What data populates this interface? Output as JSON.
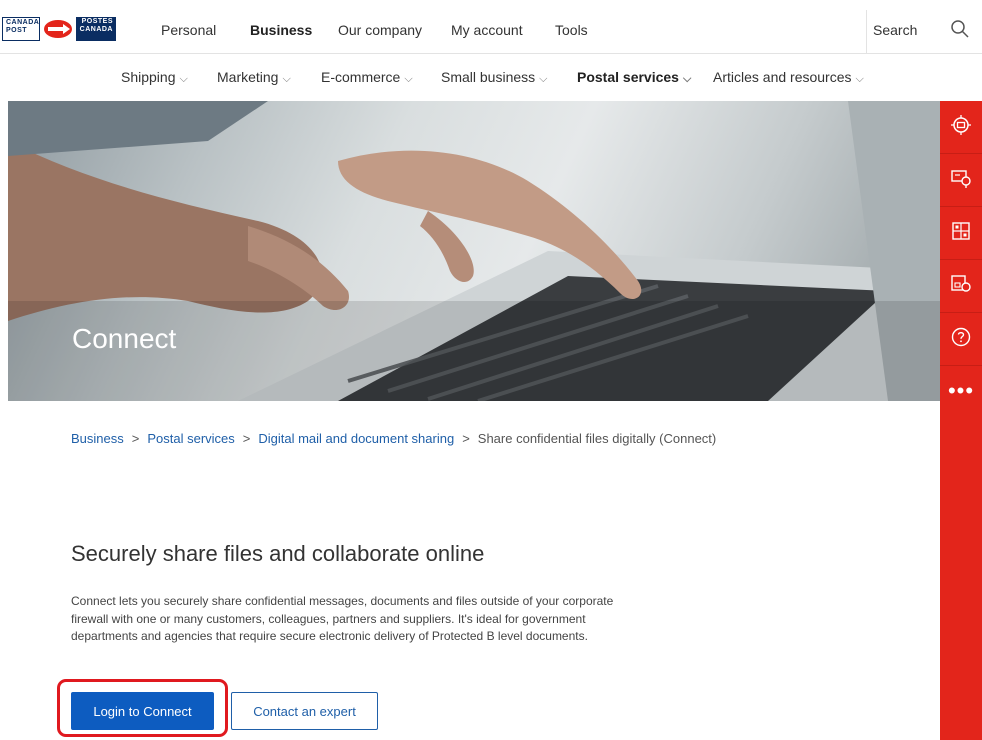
{
  "brand": {
    "left_top": "CANADA",
    "left_bottom": "POST",
    "right_top": "POSTES",
    "right_bottom": "CANADA",
    "colors": {
      "navy": "#0a2d62",
      "red": "#e3251b",
      "blue": "#0d5cc0"
    }
  },
  "topnav": {
    "items": [
      {
        "label": "Personal",
        "bold": false
      },
      {
        "label": "Business",
        "bold": true
      },
      {
        "label": "Our company",
        "bold": false
      },
      {
        "label": "My account",
        "bold": false
      },
      {
        "label": "Tools",
        "bold": false
      }
    ],
    "search_label": "Search",
    "search_icon": "search-icon"
  },
  "subnav": {
    "items": [
      {
        "label": "Shipping",
        "bold": false
      },
      {
        "label": "Marketing",
        "bold": false
      },
      {
        "label": "E-commerce",
        "bold": false
      },
      {
        "label": "Small business",
        "bold": false
      },
      {
        "label": "Postal services",
        "bold": true
      },
      {
        "label": "Articles and resources",
        "bold": false
      }
    ],
    "chevron": "⌵"
  },
  "hero": {
    "title": "Connect"
  },
  "siderail": {
    "icons": [
      "track-icon",
      "postal-code-icon",
      "rates-icon",
      "find-location-icon",
      "help-icon"
    ],
    "more": "•••"
  },
  "breadcrumb": {
    "links": [
      "Business",
      "Postal services",
      "Digital mail and document sharing"
    ],
    "current": "Share confidential files digitally (Connect)",
    "separator": ">"
  },
  "content": {
    "headline": "Securely share files and collaborate online",
    "body": "Connect lets you securely share confidential messages, documents and files outside of your corporate firewall with one or many customers, colleagues, partners and suppliers. It's ideal for government departments and agencies that require secure electronic delivery of Protected B level documents.",
    "primary_button": "Login to Connect",
    "secondary_button": "Contact an expert"
  }
}
